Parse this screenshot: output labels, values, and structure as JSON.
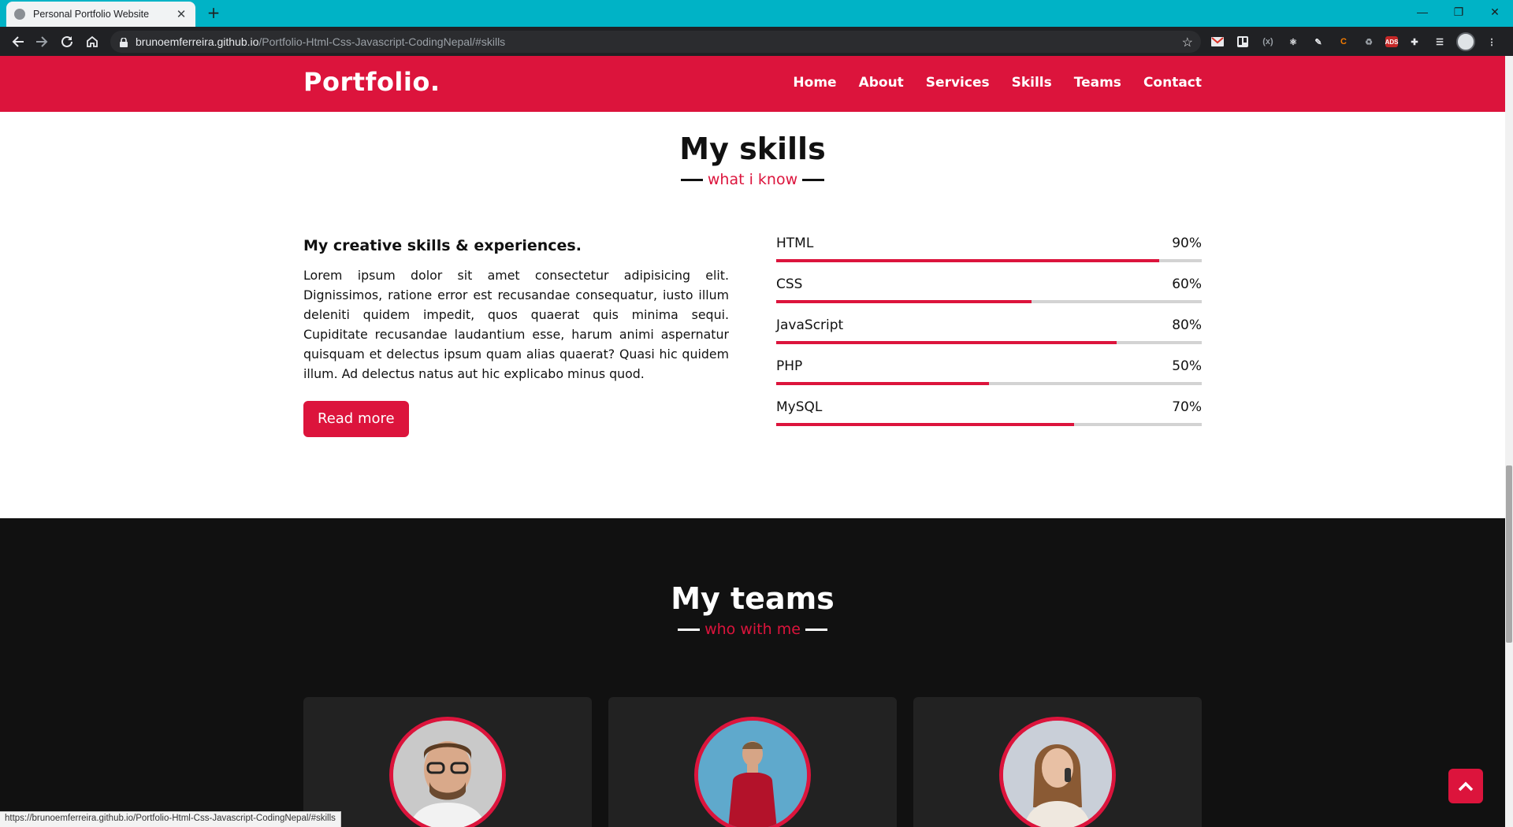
{
  "browser": {
    "tab_title": "Personal Portfolio Website",
    "url_host": "brunoemferreira.github.io",
    "url_path": "/Portfolio-Html-Css-Javascript-CodingNepal/#skills",
    "status_url": "https://brunoemferreira.github.io/Portfolio-Html-Css-Javascript-CodingNepal/#skills",
    "accent": "#00b3c6"
  },
  "nav": {
    "logo": "Portfolio.",
    "items": [
      "Home",
      "About",
      "Services",
      "Skills",
      "Teams",
      "Contact"
    ]
  },
  "skills": {
    "title": "My skills",
    "subtitle": "what i know",
    "heading": "My creative skills & experiences.",
    "text": "Lorem ipsum dolor sit amet consectetur adipisicing elit. Dignissimos, ratione error est recusandae consequatur, iusto illum deleniti quidem impedit, quos quaerat quis minima sequi. Cupiditate recusandae laudantium esse, harum animi aspernatur quisquam et delectus ipsum quam alias quaerat? Quasi hic quidem illum. Ad delectus natus aut hic explicabo minus quod.",
    "button": "Read more",
    "list": [
      {
        "name": "HTML",
        "percent": "90%",
        "value": 90
      },
      {
        "name": "CSS",
        "percent": "60%",
        "value": 60
      },
      {
        "name": "JavaScript",
        "percent": "80%",
        "value": 80
      },
      {
        "name": "PHP",
        "percent": "50%",
        "value": 50
      },
      {
        "name": "MySQL",
        "percent": "70%",
        "value": 70
      }
    ]
  },
  "teams": {
    "title": "My teams",
    "subtitle": "who with me"
  },
  "colors": {
    "brand": "#dc143c",
    "dark": "#111111",
    "card": "#222222"
  }
}
